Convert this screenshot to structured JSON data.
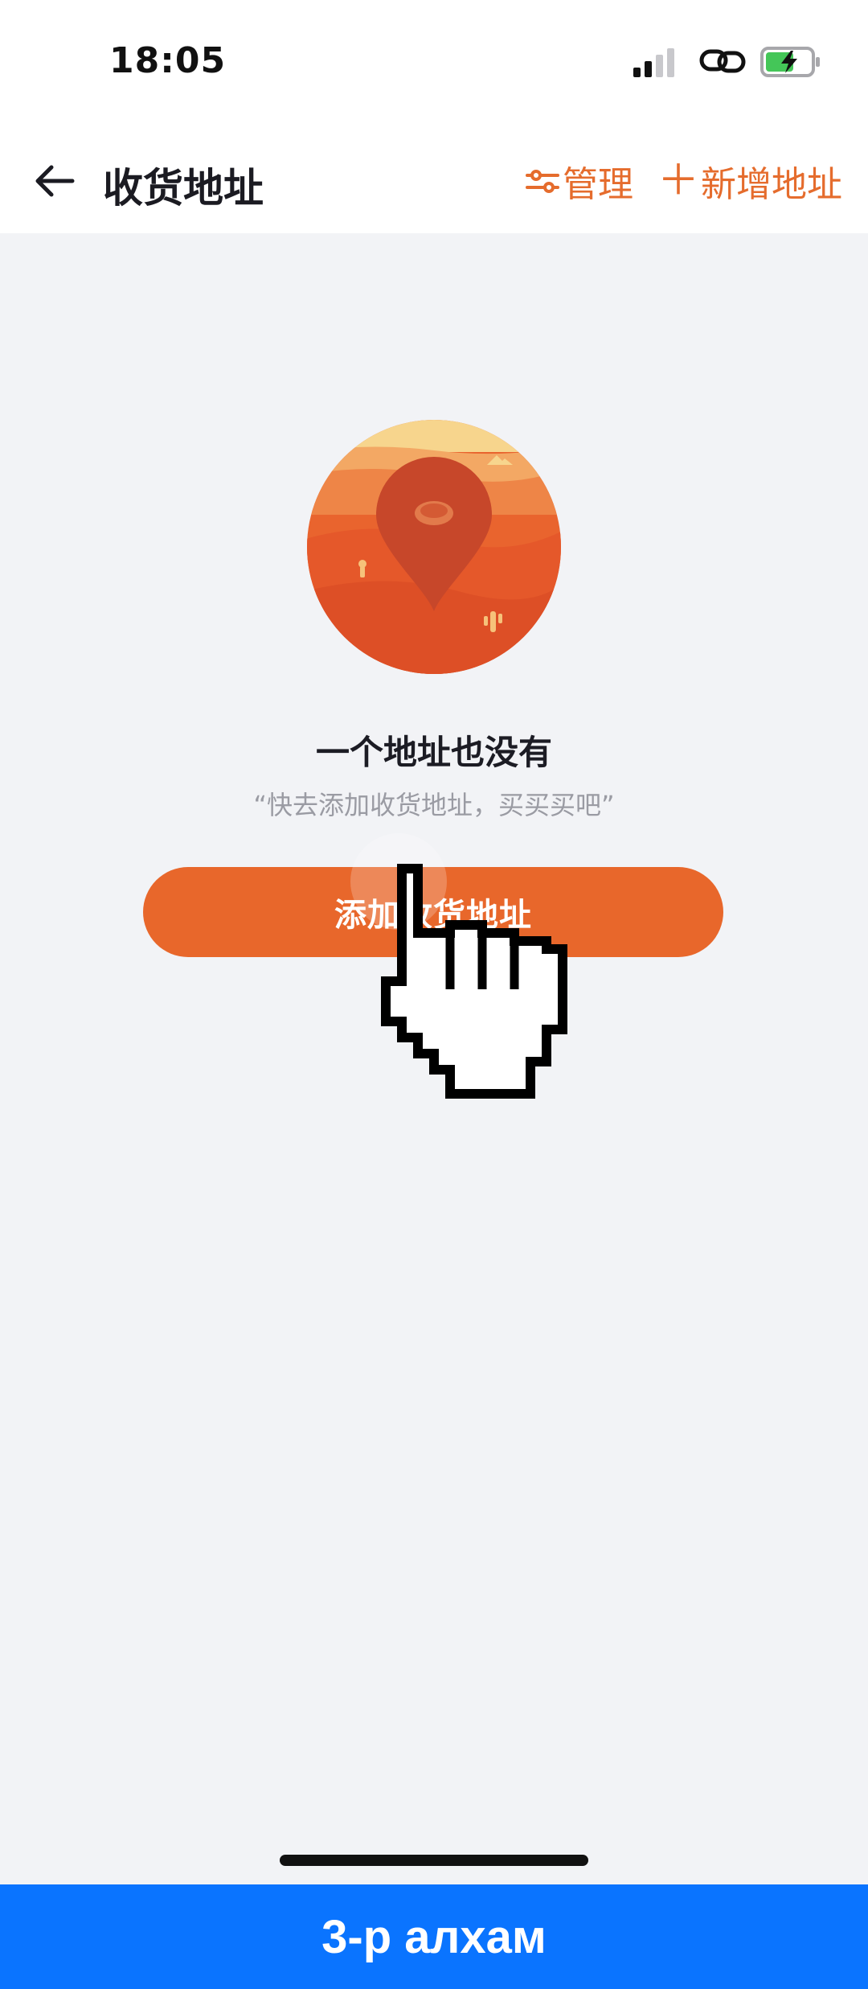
{
  "status_bar": {
    "time": "18:05",
    "icons": [
      "signal-icon",
      "link-icon",
      "battery-charging-icon"
    ]
  },
  "header": {
    "title": "收货地址",
    "manage_label": "管理",
    "add_label": "新增地址",
    "icons": [
      "back-arrow-icon",
      "sliders-icon",
      "plus-icon"
    ]
  },
  "empty_state": {
    "title": "一个地址也没有",
    "subtitle": "“快去添加收货地址，买买买吧”",
    "button_label": "添加收货地址",
    "illustration": "map-pin-desert-illustration"
  },
  "overlay": {
    "cursor": "hand-pointer-icon",
    "step_label": "3-р алхам"
  },
  "colors": {
    "accent": "#E8672B",
    "background": "#F2F3F6",
    "title": "#1C1C24",
    "subtitle": "#9A9BA3",
    "banner": "#0A74FF"
  }
}
